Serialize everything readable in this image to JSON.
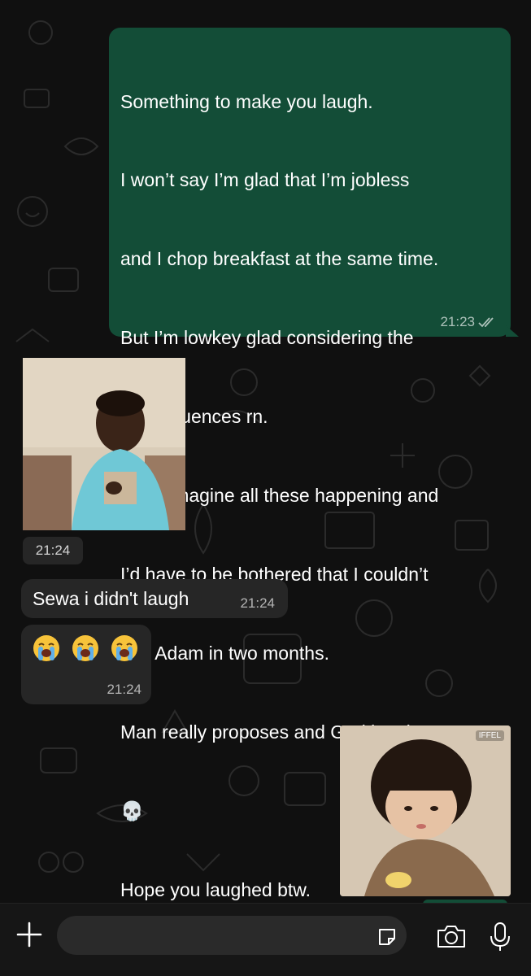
{
  "chat": {
    "messages": [
      {
        "direction": "outgoing",
        "type": "text",
        "lines": [
          "Something to make you laugh.",
          "I won’t say I’m glad that I’m jobless",
          "and I chop breakfast at the same time.",
          "But I’m lowkey glad considering the",
          "consequences rn.",
          "Can’t imagine all these happening and",
          "I’d have to be bothered that I couldn’t",
          "see Adam in two months.",
          "Man really proposes and God laughs o",
          "💀",
          "Hope you laughed btw."
        ],
        "time": "21:23",
        "status_icon": "double-check-icon"
      },
      {
        "direction": "incoming",
        "type": "image",
        "description_icon": "photo-sad-boy",
        "time": "21:24"
      },
      {
        "direction": "incoming",
        "type": "text",
        "text": "Sewa i didn't laugh",
        "time": "21:24"
      },
      {
        "direction": "incoming",
        "type": "emoji",
        "emoji_icon": "loudly-crying-face-icon",
        "emoji_count": 3,
        "time": "21:24"
      },
      {
        "direction": "outgoing",
        "type": "image",
        "description_icon": "photo-sulking-child",
        "sticker_label": "IFFEL"
      }
    ]
  },
  "input_bar": {
    "plus_icon": "plus-icon",
    "placeholder": "",
    "sticker_icon": "sticker-icon",
    "camera_icon": "camera-icon",
    "mic_icon": "microphone-icon"
  },
  "colors": {
    "background": "#101010",
    "outgoing_bubble": "#134d37",
    "incoming_bubble": "#262626",
    "input_bar": "#161616"
  }
}
